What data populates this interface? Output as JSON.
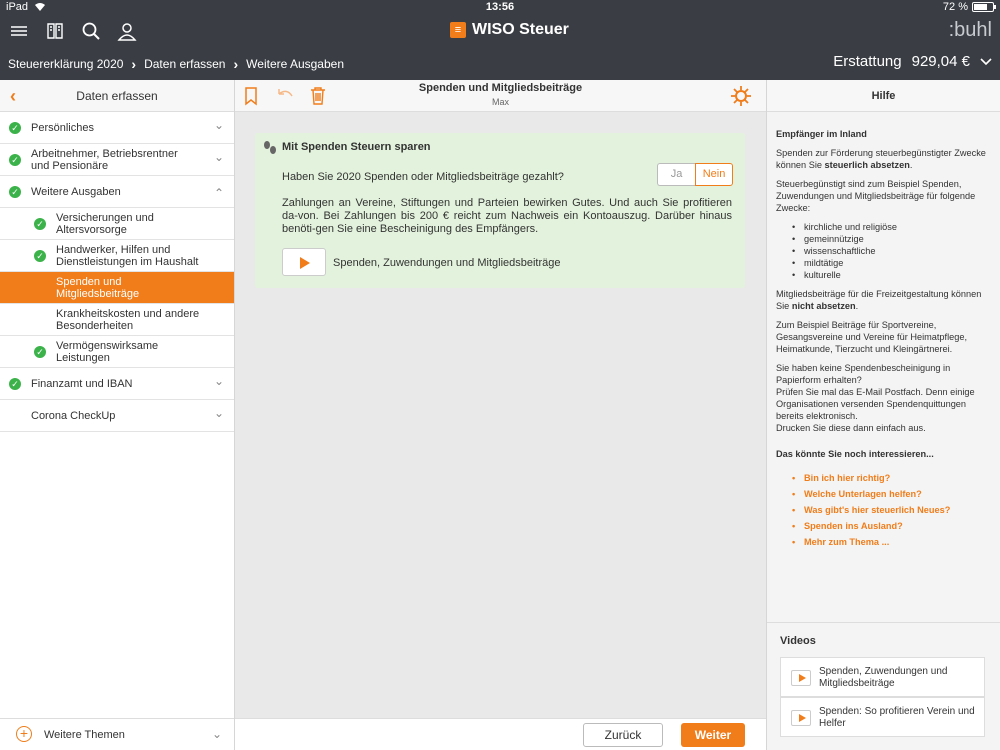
{
  "status_bar": {
    "device": "iPad",
    "time": "13:56",
    "battery_text": "72 %",
    "battery_level": 0.72
  },
  "app": {
    "logo_text": "WISO Steuer",
    "brand": ":buhl"
  },
  "breadcrumb": {
    "items": [
      "Steuererklärung 2020",
      "Daten erfassen",
      "Weitere Ausgaben"
    ]
  },
  "refund": {
    "label": "Erstattung",
    "amount": "929,04 €"
  },
  "sidebar": {
    "title": "Daten erfassen",
    "items": [
      {
        "label": "Persönliches",
        "checked": true,
        "chevron": "down"
      },
      {
        "label": "Arbeitnehmer, Betriebsrentner und Pensionäre",
        "checked": true,
        "chevron": "down"
      },
      {
        "label": "Weitere Ausgaben",
        "checked": true,
        "chevron": "up"
      },
      {
        "label": "Versicherungen und Altersvorsorge",
        "checked": true
      },
      {
        "label": "Handwerker, Hilfen und Dienstleistungen im Haushalt",
        "checked": true
      },
      {
        "label": "Spenden und Mitgliedsbeiträge",
        "checked": false,
        "active": true
      },
      {
        "label": "Krankheitskosten und andere Besonderheiten",
        "checked": false
      },
      {
        "label": "Vermögenswirksame Leistungen",
        "checked": true
      },
      {
        "label": "Finanzamt und IBAN",
        "checked": true,
        "chevron": "down"
      },
      {
        "label": "Corona CheckUp",
        "checked": false,
        "chevron": "down"
      }
    ],
    "footer": "Weitere Themen"
  },
  "main": {
    "title": "Spenden und Mitgliedsbeiträge",
    "subtitle": "Max",
    "card": {
      "title": "Mit Spenden Steuern sparen",
      "question": "Haben Sie 2020 Spenden oder Mitgliedsbeiträge gezahlt?",
      "option_yes": "Ja",
      "option_no": "Nein",
      "selected": "Nein",
      "body": "Zahlungen an Vereine, Stiftungen und Parteien bewirken Gutes. Und auch Sie profitieren da-von. Bei Zahlungen bis 200 € reicht zum Nachweis ein Kontoauszug. Darüber hinaus benöti-gen Sie eine Bescheinigung des Empfängers.",
      "video_label": "Spenden, Zuwendungen und Mitgliedsbeiträge"
    },
    "back_label": "Zurück",
    "next_label": "Weiter"
  },
  "help": {
    "title": "Hilfe",
    "heading": "Empfänger im Inland",
    "p1_a": "Spenden zur Förderung steuerbegünstigter Zwecke können Sie ",
    "p1_b": "steuerlich absetzen",
    "p1_c": ".",
    "p2": "Steuerbegünstigt sind zum Beispiel Spenden, Zuwendungen und Mitgliedsbeiträge für folgende Zwecke:",
    "purposes": [
      "kirchliche und religiöse",
      "gemeinnützige",
      "wissenschaftliche",
      "mildtätige",
      "kulturelle"
    ],
    "p3_a": "Mitgliedsbeiträge für die Freizeitgestaltung können Sie ",
    "p3_b": "nicht absetzen",
    "p3_c": ".",
    "p4": "Zum Beispiel Beiträge für Sportvereine, Gesangsvereine und Vereine für Heimatpflege, Heimatkunde, Tierzucht und Kleingärtnerei.",
    "p5_1": "Sie haben keine Spendenbescheinigung in Papierform erhalten?",
    "p5_2": "Prüfen Sie mal das E-Mail Postfach. Denn einige Organisationen versenden Spendenquittungen bereits elektronisch.",
    "p5_3": "Drucken Sie diese dann einfach aus.",
    "interest_heading": "Das könnte Sie noch interessieren...",
    "links": [
      "Bin ich hier richtig?",
      "Welche Unterlagen helfen?",
      "Was gibt's hier steuerlich Neues?",
      "Spenden ins Ausland?",
      "Mehr zum Thema ..."
    ],
    "videos_heading": "Videos",
    "videos": [
      "Spenden, Zuwendungen und Mitgliedsbeiträge",
      "Spenden: So profitieren Verein und Helfer"
    ]
  },
  "colors": {
    "accent": "#f07d1a",
    "header": "#3a3e44",
    "check": "#3cb34a",
    "card": "#e3f2dc"
  }
}
